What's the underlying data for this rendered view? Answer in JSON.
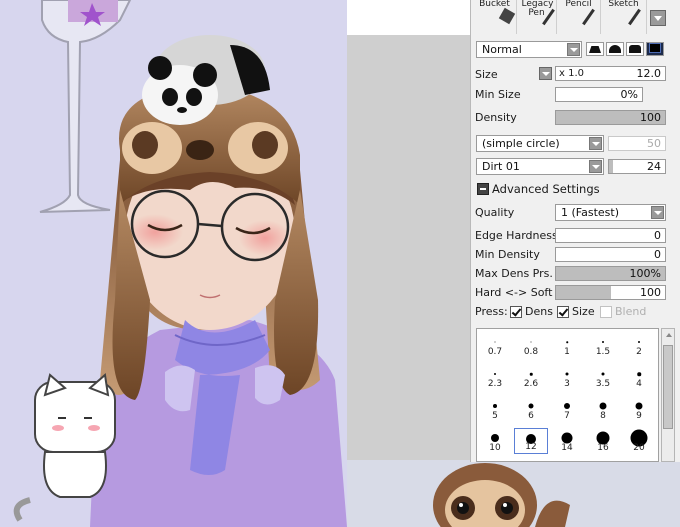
{
  "tools": {
    "items": [
      {
        "label": "Bucket",
        "icon": "bucket-icon"
      },
      {
        "label": "Legacy Pen",
        "icon": "pen-icon"
      },
      {
        "label": "Pencil",
        "icon": "pencil-icon"
      },
      {
        "label": "Sketch",
        "icon": "sketch-icon"
      }
    ]
  },
  "brush": {
    "blend_mode": "Normal",
    "size_label": "Size",
    "size_multiplier": "x 1.0",
    "size_value": "12.0",
    "min_size_label": "Min Size",
    "min_size_value": "0%",
    "density_label": "Density",
    "density_value": "100",
    "density_fill": 1.0,
    "shape": "(simple circle)",
    "shape_value": "50",
    "texture": "Dirt 01",
    "texture_value": "24",
    "texture_fill": 0.08
  },
  "advanced": {
    "title": "Advanced Settings",
    "quality_label": "Quality",
    "quality_value": "1 (Fastest)",
    "edge_hardness_label": "Edge Hardness",
    "edge_hardness_value": "0",
    "min_density_label": "Min Density",
    "min_density_value": "0",
    "max_dens_prs_label": "Max Dens Prs.",
    "max_dens_prs_value": "100%",
    "max_dens_prs_fill": 1.0,
    "hard_soft_label": "Hard <-> Soft",
    "hard_soft_value": "100",
    "hard_soft_fill": 0.5,
    "press_label": "Press:",
    "press_dens": "Dens",
    "press_size": "Size",
    "press_blend": "Blend"
  },
  "brush_sizes": {
    "rows": [
      [
        {
          "v": "0.7",
          "d": 1
        },
        {
          "v": "0.8",
          "d": 1
        },
        {
          "v": "1",
          "d": 1.5
        },
        {
          "v": "1.5",
          "d": 2
        },
        {
          "v": "2",
          "d": 2
        }
      ],
      [
        {
          "v": "2.3",
          "d": 2
        },
        {
          "v": "2.6",
          "d": 2.5
        },
        {
          "v": "3",
          "d": 3
        },
        {
          "v": "3.5",
          "d": 3
        },
        {
          "v": "4",
          "d": 3.5
        }
      ],
      [
        {
          "v": "5",
          "d": 4
        },
        {
          "v": "6",
          "d": 5
        },
        {
          "v": "7",
          "d": 6
        },
        {
          "v": "8",
          "d": 7
        },
        {
          "v": "9",
          "d": 7
        }
      ],
      [
        {
          "v": "10",
          "d": 8
        },
        {
          "v": "12",
          "d": 10
        },
        {
          "v": "14",
          "d": 11
        },
        {
          "v": "16",
          "d": 13
        },
        {
          "v": "20",
          "d": 17
        }
      ]
    ],
    "selected": "12"
  },
  "colors": {
    "canvas_bg": "#d7d6ee",
    "sweater": "#b69ae0",
    "scarf": "#8f86e4",
    "hair": "#6b4128",
    "skin": "#f2d8cb",
    "hood": "#a57a57"
  }
}
